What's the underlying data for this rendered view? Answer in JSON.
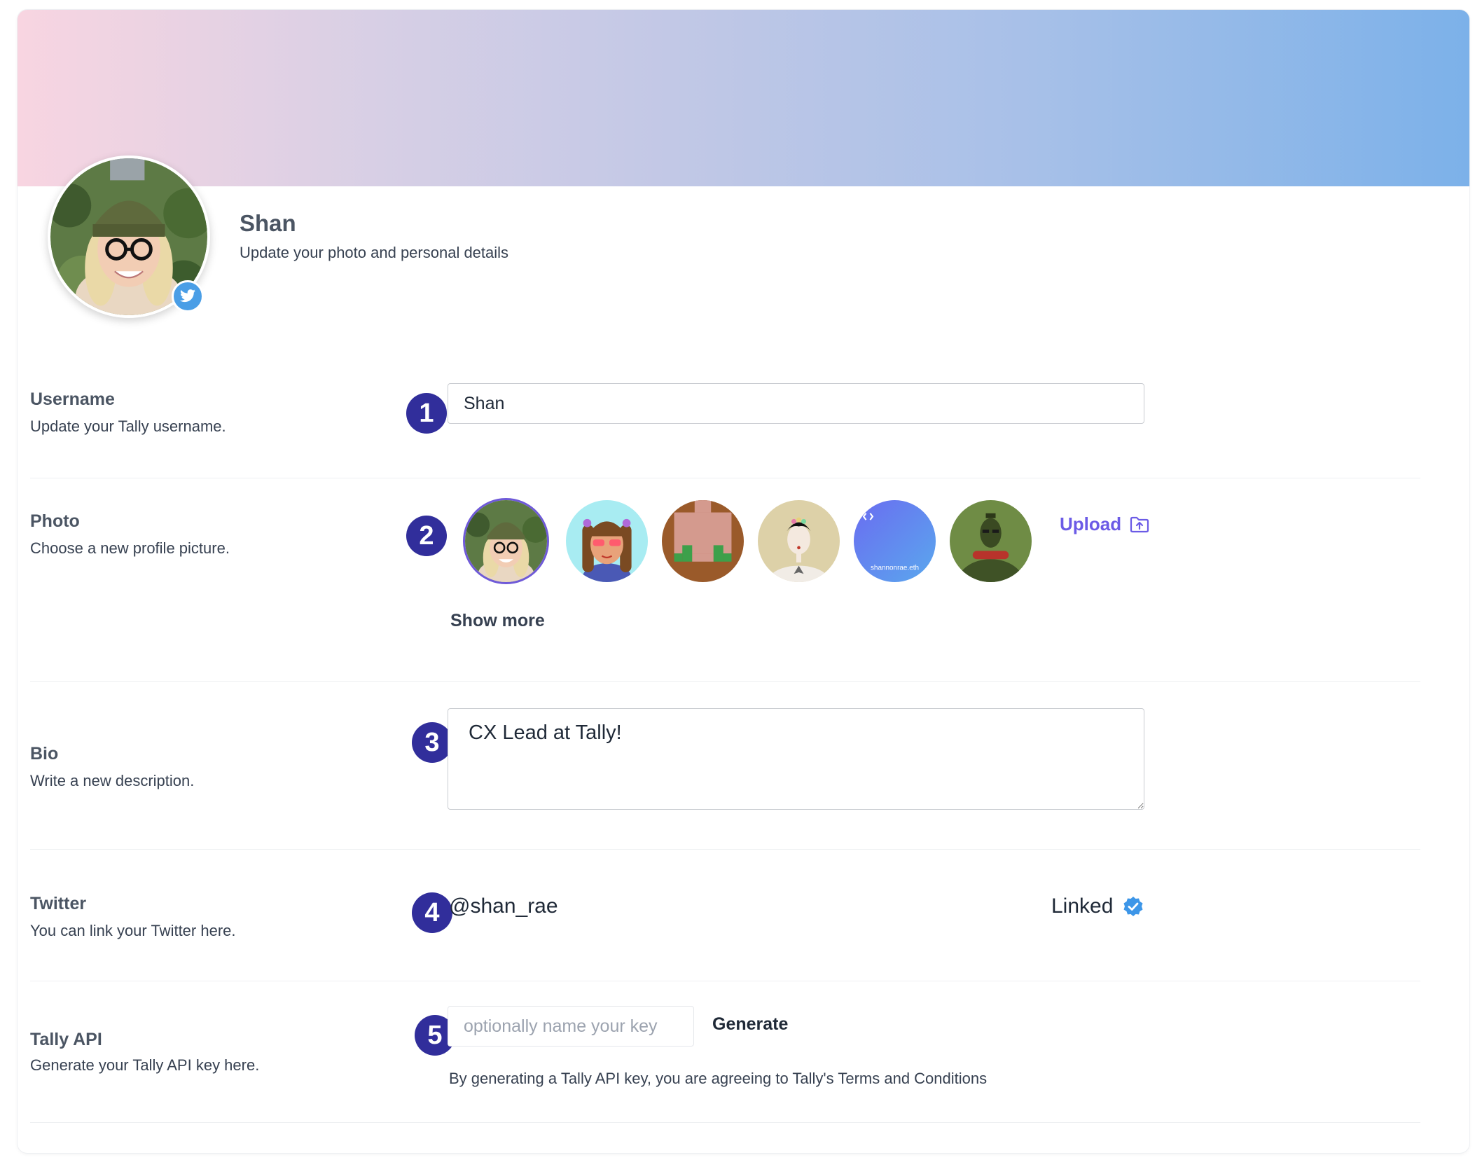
{
  "profile": {
    "name": "Shan",
    "subtitle": "Update your photo and personal details"
  },
  "username": {
    "label": "Username",
    "description": "Update your Tally username.",
    "step": "1",
    "value": "Shan"
  },
  "photo": {
    "label": "Photo",
    "description": "Choose a new profile picture.",
    "step": "2",
    "upload_label": "Upload",
    "show_more_label": "Show more",
    "thumb_5_text": "shannonrae.eth"
  },
  "bio": {
    "label": "Bio",
    "description": "Write a new description.",
    "step": "3",
    "value": "CX Lead at Tally!"
  },
  "twitter": {
    "label": "Twitter",
    "description": "You can link your Twitter here.",
    "step": "4",
    "handle": "@shan_rae",
    "status": "Linked"
  },
  "api": {
    "label": "Tally API",
    "description": "Generate your Tally API key here.",
    "step": "5",
    "placeholder": "optionally name your key",
    "generate_label": "Generate",
    "terms": "By generating a Tally API key, you are agreeing to Tally's Terms and Conditions"
  },
  "colors": {
    "step_circle": "#312e9b",
    "accent": "#6b5be6",
    "twitter_blue": "#4a9ee6"
  },
  "icons": [
    "twitter-icon",
    "upload-folder-icon",
    "verified-check-icon"
  ]
}
